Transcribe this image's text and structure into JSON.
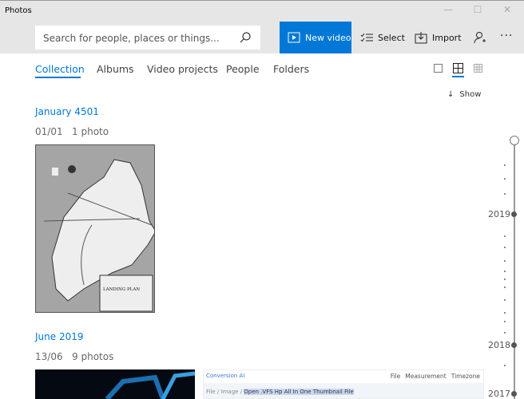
{
  "app": {
    "title": "Photos"
  },
  "toolbar": {
    "search_placeholder": "Search for people, places or things...",
    "new_video": "New video",
    "select": "Select",
    "import": "Import"
  },
  "tabs": [
    {
      "label": "Collection"
    },
    {
      "label": "Albums"
    },
    {
      "label": "Video projects"
    },
    {
      "label": "People"
    },
    {
      "label": "Folders"
    }
  ],
  "show_label": "Show",
  "groups": [
    {
      "title": "January 4501",
      "date": "01/01",
      "count": "1 photo",
      "map_text": "LANDING PLAN"
    },
    {
      "title": "June 2019",
      "date": "13/06",
      "count": "9 photos",
      "shot_brand": "Conversion AI",
      "shot_menu": [
        "File",
        "Measurement",
        "Timezone"
      ],
      "shot_crumbs": [
        "File",
        "Image"
      ],
      "shot_highlight": "Open .VFS Hp All In One Thumbnail File"
    }
  ],
  "timeline": {
    "years": [
      "2019",
      "2018",
      "2017"
    ]
  },
  "accent": "#0078d7"
}
